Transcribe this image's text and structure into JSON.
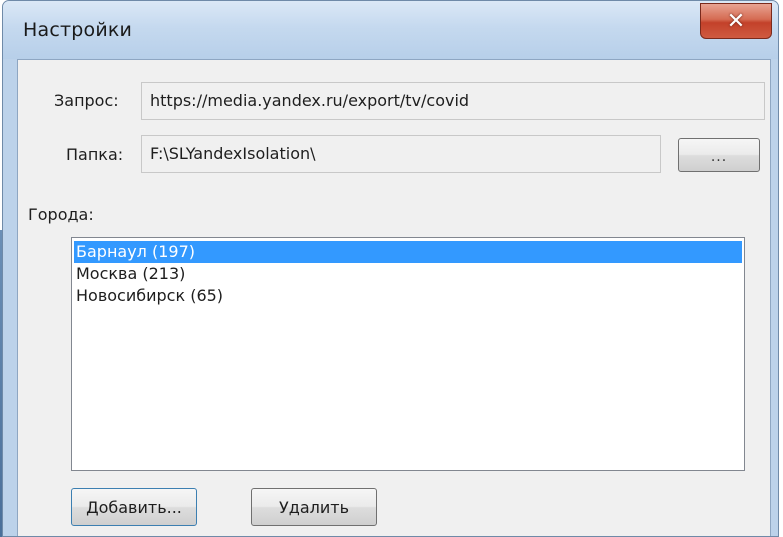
{
  "window": {
    "title": "Настройки"
  },
  "form": {
    "request_label": "Запрос:",
    "request_value": "https://media.yandex.ru/export/tv/covid",
    "folder_label": "Папка:",
    "folder_value": "F:\\SLYandexIsolation\\",
    "browse_label": "...",
    "cities_label": "Города:"
  },
  "cities": {
    "items": [
      {
        "label": "Барнаул (197)",
        "selected": true
      },
      {
        "label": "Москва (213)",
        "selected": false
      },
      {
        "label": "Новосибирск (65)",
        "selected": false
      }
    ]
  },
  "buttons": {
    "add_label": "Добавить...",
    "delete_label": "Удалить"
  },
  "icons": {
    "close": "close-icon"
  },
  "colors": {
    "selection": "#3399ff",
    "close_button": "#c3412a"
  }
}
